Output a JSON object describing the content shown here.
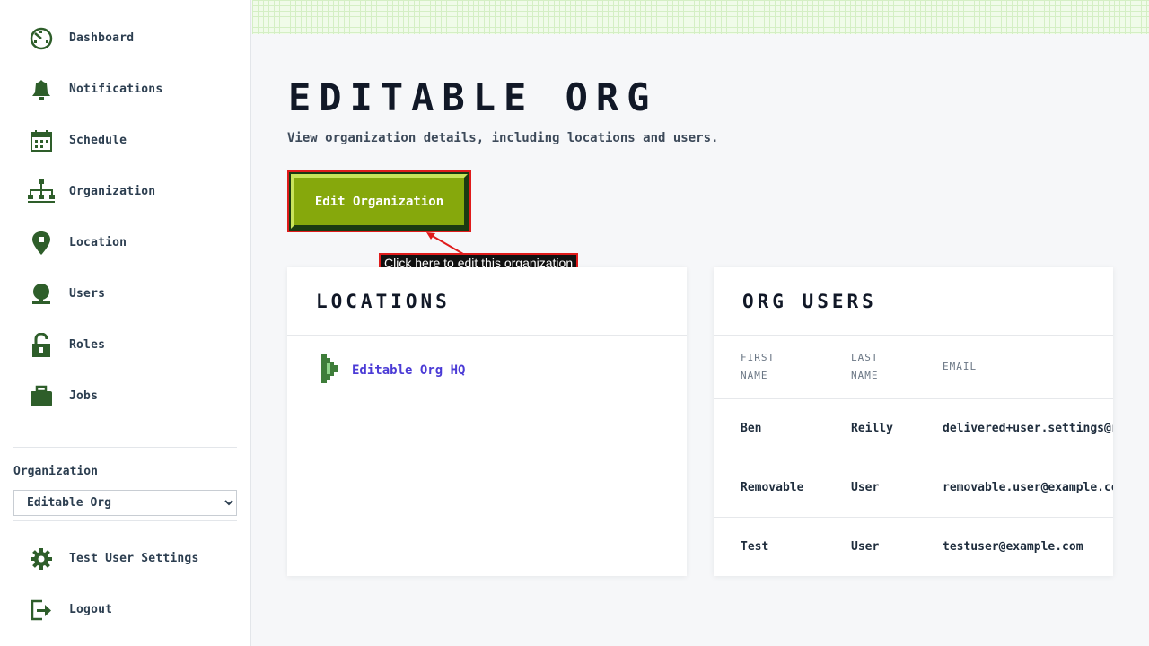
{
  "sidebar": {
    "items": [
      {
        "label": "Dashboard",
        "icon": "dashboard-icon"
      },
      {
        "label": "Notifications",
        "icon": "bell-icon"
      },
      {
        "label": "Schedule",
        "icon": "calendar-icon"
      },
      {
        "label": "Organization",
        "icon": "org-chart-icon"
      },
      {
        "label": "Location",
        "icon": "map-pin-icon"
      },
      {
        "label": "Users",
        "icon": "user-icon"
      },
      {
        "label": "Roles",
        "icon": "lock-icon"
      },
      {
        "label": "Jobs",
        "icon": "briefcase-icon"
      }
    ],
    "org_label": "Organization",
    "org_selected": "Editable Org",
    "bottom_items": [
      {
        "label": "Test User Settings",
        "icon": "gear-icon"
      },
      {
        "label": "Logout",
        "icon": "logout-icon"
      }
    ]
  },
  "main": {
    "title": "EDITABLE ORG",
    "subtitle": "View organization details, including locations and users.",
    "edit_button": "Edit Organization",
    "tooltip": "Click here to edit this organization",
    "locations": {
      "title": "LOCATIONS",
      "items": [
        "Editable Org HQ"
      ]
    },
    "org_users": {
      "title": "ORG USERS",
      "headers": {
        "first": "First Name",
        "last": "Last Name",
        "email": "Email"
      },
      "rows": [
        {
          "first": "Ben",
          "last": "Reilly",
          "email": "delivered+user.settings@res"
        },
        {
          "first": "Removable",
          "last": "User",
          "email": "removable.user@example.com"
        },
        {
          "first": "Test",
          "last": "User",
          "email": "testuser@example.com"
        }
      ]
    }
  },
  "colors": {
    "icon_green": "#2e5e2a",
    "button_green": "#86a80c",
    "link_purple": "#4b3bd6",
    "annotation_red": "#e01b1b"
  }
}
